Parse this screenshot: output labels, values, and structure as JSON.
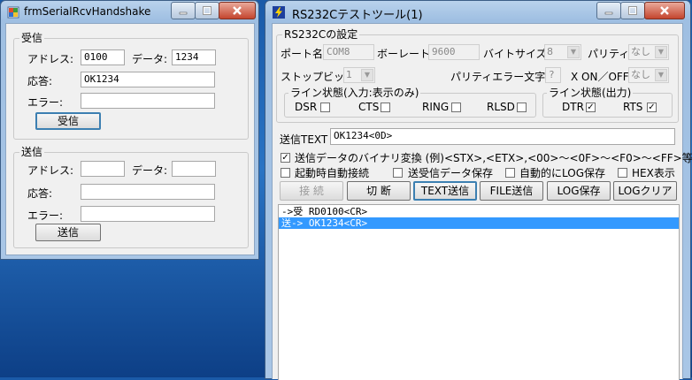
{
  "left_window": {
    "title": "frmSerialRcvHandshake",
    "receive_group": {
      "legend": "受信",
      "address_label": "アドレス:",
      "address_value": "0100",
      "data_label": "データ:",
      "data_value": "1234",
      "response_label": "応答:",
      "response_value": "OK1234",
      "error_label": "エラー:",
      "error_value": "",
      "button_label": "受信"
    },
    "send_group": {
      "legend": "送信",
      "address_label": "アドレス:",
      "address_value": "",
      "data_label": "データ:",
      "data_value": "",
      "response_label": "応答:",
      "response_value": "",
      "error_label": "エラー:",
      "error_value": "",
      "button_label": "送信"
    }
  },
  "right_window": {
    "title": "RS232Cテストツール(1)",
    "settings": {
      "legend": "RS232Cの設定",
      "port_label": "ポート名",
      "port_value": "COM8",
      "baud_label": "ボーレート",
      "baud_value": "9600",
      "bytesize_label": "バイトサイズ",
      "bytesize_value": "8",
      "parity_label": "パリティ",
      "parity_value": "なし",
      "stopbit_label": "ストップビット",
      "stopbit_value": "1",
      "parity_error_label": "パリティエラー文字",
      "parity_error_value": "?",
      "xonoff_label": "X ON／OFF",
      "xonoff_value": "なし"
    },
    "line_in": {
      "legend": "ライン状態(入力:表示のみ)",
      "items": [
        {
          "label": "DSR",
          "checked": false
        },
        {
          "label": "CTS",
          "checked": false
        },
        {
          "label": "RING",
          "checked": false
        },
        {
          "label": "RLSD",
          "checked": false
        }
      ]
    },
    "line_out": {
      "legend": "ライン状態(出力)",
      "items": [
        {
          "label": "DTR",
          "checked": true
        },
        {
          "label": "RTS",
          "checked": true
        }
      ]
    },
    "send_text_label": "送信TEXT",
    "send_text_value": "OK1234<0D>",
    "binary_convert_label": "送信データのバイナリ変換 (例)<STX>,<ETX>,<00>～<0F>～<F0>～<FF>等",
    "binary_convert_checked": true,
    "options": {
      "auto_connect": "起動時自動接続",
      "save_data": "送受信データ保存",
      "auto_log": "自動的にLOG保存",
      "hex_display": "HEX表示"
    },
    "buttons": {
      "connect": "接 続",
      "disconnect": "切 断",
      "text_send": "TEXT送信",
      "file_send": "FILE送信",
      "log_save": "LOG保存",
      "log_clear": "LOGクリア"
    },
    "log_lines": [
      "->受 RD0100<CR>",
      "送-> OK1234<CR>"
    ]
  },
  "colors": {
    "selection": "#3399ff",
    "close_button": "#c4452e",
    "desktop": "#1a5aa8"
  }
}
